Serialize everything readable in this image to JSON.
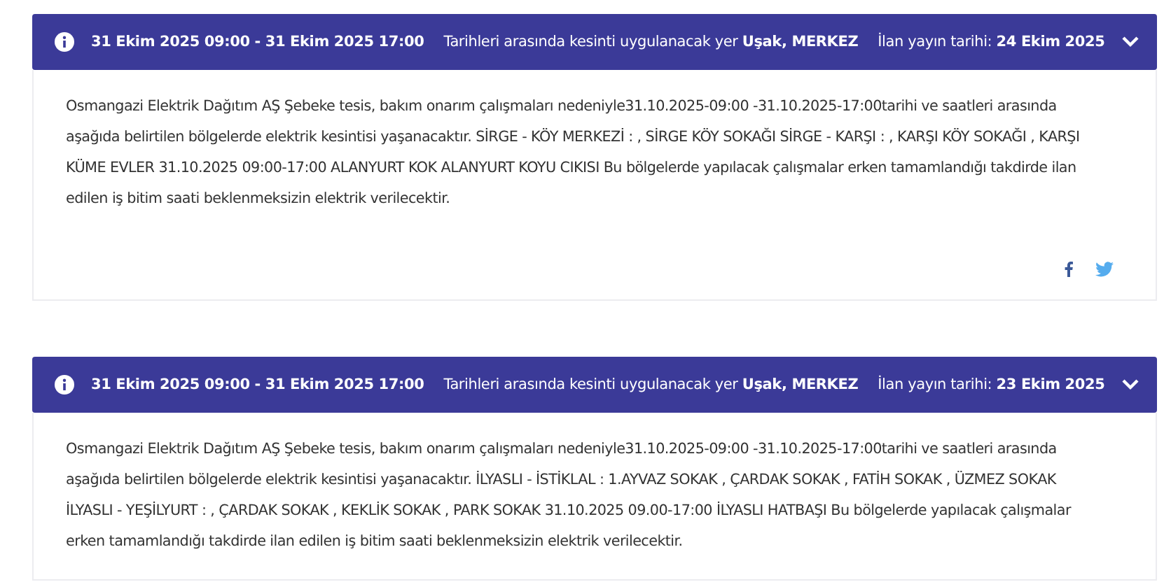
{
  "notices": [
    {
      "date_range": "31 Ekim 2025 09:00 - 31 Ekim 2025 17:00",
      "location": "Tarihleri arasında kesinti uygulanacak yer **Uşak, MERKEZ**",
      "published": "İlan yayın tarihi: **24 Ekim 2025**",
      "expanded": true,
      "share": true,
      "body": "Osmangazi Elektrik Dağıtım AŞ Şebeke tesis, bakım onarım çalışmaları nedeniyle31.10.2025-09:00 -31.10.2025-17:00tarihi ve saatleri arasında aşağıda belirtilen bölgelerde elektrik kesintisi yaşanacaktır. SİRGE - KÖY MERKEZİ : , SİRGE KÖY SOKAĞI SİRGE - KARŞI : , KARŞI KÖY SOKAĞI , KARŞI KÜME EVLER 31.10.2025 09:00-17:00 ALANYURT KOK ALANYURT KOYU CIKISI Bu bölgelerde yapılacak çalışmalar erken tamamlandığı takdirde ilan edilen iş bitim saati beklenmeksizin elektrik verilecektir."
    },
    {
      "date_range": "31 Ekim 2025 09:00 - 31 Ekim 2025 17:00",
      "location": "Tarihleri arasında kesinti uygulanacak yer **Uşak, MERKEZ**",
      "published": "İlan yayın tarihi: **23 Ekim 2025**",
      "expanded": true,
      "body": "Osmangazi Elektrik Dağıtım AŞ Şebeke tesis, bakım onarım çalışmaları nedeniyle31.10.2025-09:00 -31.10.2025-17:00tarihi ve saatleri arasında aşağıda belirtilen bölgelerde elektrik kesintisi yaşanacaktır. İLYASLI - İSTİKLAL : 1.AYVAZ SOKAK , ÇARDAK SOKAK , FATİH SOKAK , ÜZMEZ SOKAK İLYASLI - YEŞİLYURT : , ÇARDAK SOKAK , KEKLİK SOKAK , PARK SOKAK 31.10.2025 09.00-17:00 İLYASLI HATBAŞI Bu bölgelerde yapılacak çalışmalar erken tamamlandığı takdirde ilan edilen iş bitim saati beklenmeksizin elektrik verilecektir."
    }
  ]
}
